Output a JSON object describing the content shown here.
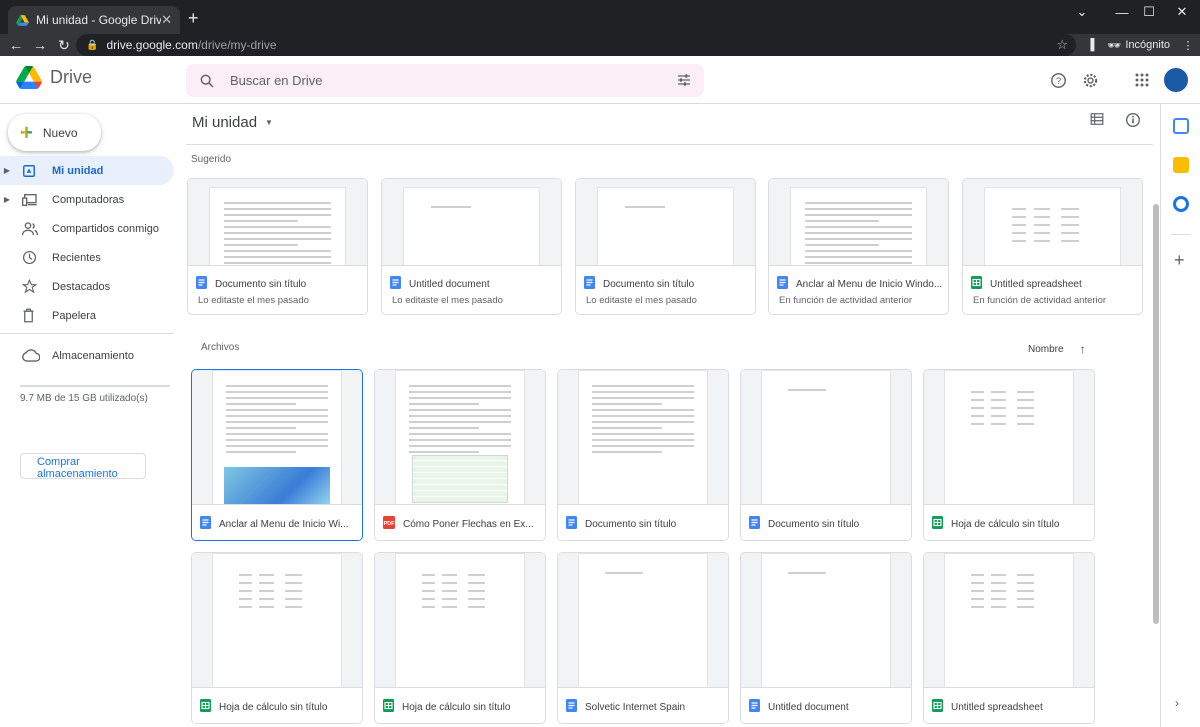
{
  "browser": {
    "tab_title": "Mi unidad - Google Drive",
    "url_host": "drive.google.com",
    "url_path": "/drive/my-drive",
    "profile_label": "Incógnito"
  },
  "header": {
    "app_name": "Drive",
    "search_placeholder": "Buscar en Drive"
  },
  "sidebar": {
    "new_label": "Nuevo",
    "items": [
      {
        "label": "Mi unidad",
        "icon": "my-drive-icon",
        "active": true
      },
      {
        "label": "Computadoras",
        "icon": "computer-icon"
      },
      {
        "label": "Compartidos conmigo",
        "icon": "people-icon"
      },
      {
        "label": "Recientes",
        "icon": "clock-icon"
      },
      {
        "label": "Destacados",
        "icon": "star-icon"
      },
      {
        "label": "Papelera",
        "icon": "trash-icon"
      }
    ],
    "storage_label": "Almacenamiento",
    "storage_usage": "9.7 MB de 15 GB utilizado(s)",
    "buy_label": "Comprar almacenamiento"
  },
  "main": {
    "title": "Mi unidad",
    "suggested_title": "Sugerido",
    "files_title": "Archivos",
    "sort_label": "Nombre",
    "suggested": [
      {
        "name": "Documento sin título",
        "sub": "Lo editaste el mes pasado",
        "type": "doc"
      },
      {
        "name": "Untitled document",
        "sub": "Lo editaste el mes pasado",
        "type": "doc"
      },
      {
        "name": "Documento sin título",
        "sub": "Lo editaste el mes pasado",
        "type": "doc"
      },
      {
        "name": "Anclar al Menu de Inicio Windo...",
        "sub": "En función de actividad anterior",
        "type": "doc"
      },
      {
        "name": "Untitled spreadsheet",
        "sub": "En función de actividad anterior",
        "type": "sheet"
      }
    ],
    "files": [
      {
        "name": "Anclar al Menu de Inicio Wi...",
        "type": "doc"
      },
      {
        "name": "Cómo Poner Flechas en Ex...",
        "type": "pdf"
      },
      {
        "name": "Documento sin título",
        "type": "doc"
      },
      {
        "name": "Documento sin título",
        "type": "doc"
      },
      {
        "name": "Hoja de cálculo sin título",
        "type": "sheet"
      },
      {
        "name": "Hoja de cálculo sin título",
        "type": "sheet"
      },
      {
        "name": "Hoja de cálculo sin título",
        "type": "sheet"
      },
      {
        "name": "Solvetic Internet Spain",
        "type": "doc"
      },
      {
        "name": "Untitled document",
        "type": "doc"
      },
      {
        "name": "Untitled spreadsheet",
        "type": "sheet"
      }
    ]
  },
  "colors": {
    "doc": "#4285f4",
    "sheet": "#0f9d58",
    "pdf": "#ea4335",
    "active_bg": "#e8f0fe",
    "active_fg": "#1967d2"
  }
}
